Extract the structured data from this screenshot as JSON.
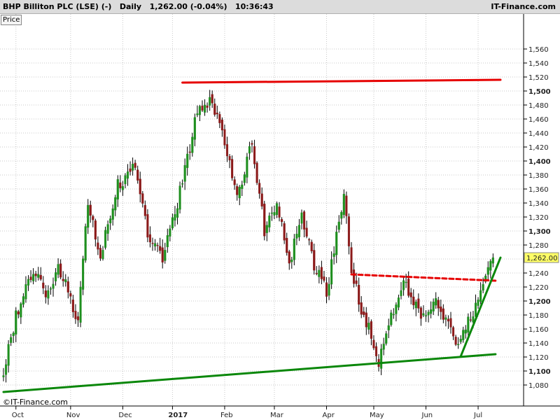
{
  "header": {
    "info": "BHP Billiton PLC (LSE) (-)   Daily   1,262.00 (-0.04%)   10:36:43",
    "source": "IT-Finance.com"
  },
  "price_tag": "Price",
  "copyright": "©IT-Finance.com",
  "colors": {
    "up": "#1f8f1f",
    "down": "#8b1a1a",
    "resistance": "#e60000",
    "support": "#0a870a",
    "last_price_label_bg": "#ffff66"
  },
  "chart_data": {
    "type": "candlestick",
    "title": "BHP Billiton PLC (LSE)",
    "interval": "Daily",
    "last_price": 1262.0,
    "last_price_label": "1,262.00",
    "change": "-0.04%",
    "time": "10:36:43",
    "ylim": [
      1060,
      1570
    ],
    "y_ticks": [
      {
        "value": 1080,
        "label": "1,080",
        "major": false
      },
      {
        "value": 1100,
        "label": "1,100",
        "major": true
      },
      {
        "value": 1120,
        "label": "1,120",
        "major": false
      },
      {
        "value": 1140,
        "label": "1,140",
        "major": false
      },
      {
        "value": 1160,
        "label": "1,160",
        "major": false
      },
      {
        "value": 1180,
        "label": "1,180",
        "major": false
      },
      {
        "value": 1200,
        "label": "1,200",
        "major": true
      },
      {
        "value": 1220,
        "label": "1,220",
        "major": false
      },
      {
        "value": 1240,
        "label": "1,240",
        "major": false
      },
      {
        "value": 1260,
        "label": "1,260",
        "major": false
      },
      {
        "value": 1280,
        "label": "1,280",
        "major": false
      },
      {
        "value": 1300,
        "label": "1,300",
        "major": true
      },
      {
        "value": 1320,
        "label": "1,320",
        "major": false
      },
      {
        "value": 1340,
        "label": "1,340",
        "major": false
      },
      {
        "value": 1360,
        "label": "1,360",
        "major": false
      },
      {
        "value": 1380,
        "label": "1,380",
        "major": false
      },
      {
        "value": 1400,
        "label": "1,400",
        "major": true
      },
      {
        "value": 1420,
        "label": "1,420",
        "major": false
      },
      {
        "value": 1440,
        "label": "1,440",
        "major": false
      },
      {
        "value": 1460,
        "label": "1,460",
        "major": false
      },
      {
        "value": 1480,
        "label": "1,480",
        "major": false
      },
      {
        "value": 1500,
        "label": "1,500",
        "major": true
      },
      {
        "value": 1520,
        "label": "1,520",
        "major": false
      },
      {
        "value": 1540,
        "label": "1,540",
        "major": false
      },
      {
        "value": 1560,
        "label": "1,560",
        "major": false
      }
    ],
    "x_ticks": [
      {
        "label": "Oct",
        "bar": 5,
        "major": false
      },
      {
        "label": "Nov",
        "bar": 27,
        "major": false
      },
      {
        "label": "Dec",
        "bar": 48,
        "major": false
      },
      {
        "label": "2017",
        "bar": 68,
        "major": true
      },
      {
        "label": "Feb",
        "bar": 89,
        "major": false
      },
      {
        "label": "Mar",
        "bar": 109,
        "major": false
      },
      {
        "label": "Apr",
        "bar": 130,
        "major": false
      },
      {
        "label": "May",
        "bar": 149,
        "major": false
      },
      {
        "label": "Jun",
        "bar": 170,
        "major": false
      },
      {
        "label": "Jul",
        "bar": 191,
        "major": false
      }
    ],
    "trendlines": [
      {
        "name": "resistance",
        "style": "solid",
        "color": "red",
        "start": {
          "bar": 72,
          "value": 1512
        },
        "end": {
          "bar": 200,
          "value": 1516
        }
      },
      {
        "name": "neckline",
        "style": "dashed",
        "color": "red",
        "start": {
          "bar": 140,
          "value": 1238
        },
        "end": {
          "bar": 198,
          "value": 1229
        }
      },
      {
        "name": "long-term-support",
        "style": "solid",
        "color": "green",
        "start": {
          "bar": 0,
          "value": 1070
        },
        "end": {
          "bar": 198,
          "value": 1124
        }
      },
      {
        "name": "short-term-support",
        "style": "solid",
        "color": "green",
        "start": {
          "bar": 184,
          "value": 1121
        },
        "end": {
          "bar": 200,
          "value": 1262
        }
      }
    ],
    "anchors": [
      {
        "bar": 0,
        "value": 1095
      },
      {
        "bar": 5,
        "value": 1180
      },
      {
        "bar": 12,
        "value": 1245
      },
      {
        "bar": 17,
        "value": 1205
      },
      {
        "bar": 22,
        "value": 1250
      },
      {
        "bar": 30,
        "value": 1175
      },
      {
        "bar": 34,
        "value": 1340
      },
      {
        "bar": 39,
        "value": 1265
      },
      {
        "bar": 46,
        "value": 1365
      },
      {
        "bar": 53,
        "value": 1390
      },
      {
        "bar": 58,
        "value": 1300
      },
      {
        "bar": 64,
        "value": 1260
      },
      {
        "bar": 70,
        "value": 1340
      },
      {
        "bar": 75,
        "value": 1420
      },
      {
        "bar": 78,
        "value": 1470
      },
      {
        "bar": 83,
        "value": 1490
      },
      {
        "bar": 87,
        "value": 1450
      },
      {
        "bar": 91,
        "value": 1400
      },
      {
        "bar": 94,
        "value": 1350
      },
      {
        "bar": 97,
        "value": 1385
      },
      {
        "bar": 100,
        "value": 1430
      },
      {
        "bar": 105,
        "value": 1300
      },
      {
        "bar": 110,
        "value": 1345
      },
      {
        "bar": 115,
        "value": 1255
      },
      {
        "bar": 120,
        "value": 1320
      },
      {
        "bar": 125,
        "value": 1250
      },
      {
        "bar": 130,
        "value": 1215
      },
      {
        "bar": 134,
        "value": 1290
      },
      {
        "bar": 137,
        "value": 1350
      },
      {
        "bar": 140,
        "value": 1250
      },
      {
        "bar": 143,
        "value": 1200
      },
      {
        "bar": 148,
        "value": 1150
      },
      {
        "bar": 151,
        "value": 1110
      },
      {
        "bar": 155,
        "value": 1170
      },
      {
        "bar": 159,
        "value": 1210
      },
      {
        "bar": 162,
        "value": 1225
      },
      {
        "bar": 166,
        "value": 1190
      },
      {
        "bar": 170,
        "value": 1175
      },
      {
        "bar": 174,
        "value": 1195
      },
      {
        "bar": 179,
        "value": 1175
      },
      {
        "bar": 183,
        "value": 1130
      },
      {
        "bar": 187,
        "value": 1170
      },
      {
        "bar": 191,
        "value": 1205
      },
      {
        "bar": 195,
        "value": 1245
      },
      {
        "bar": 197,
        "value": 1262
      }
    ]
  }
}
